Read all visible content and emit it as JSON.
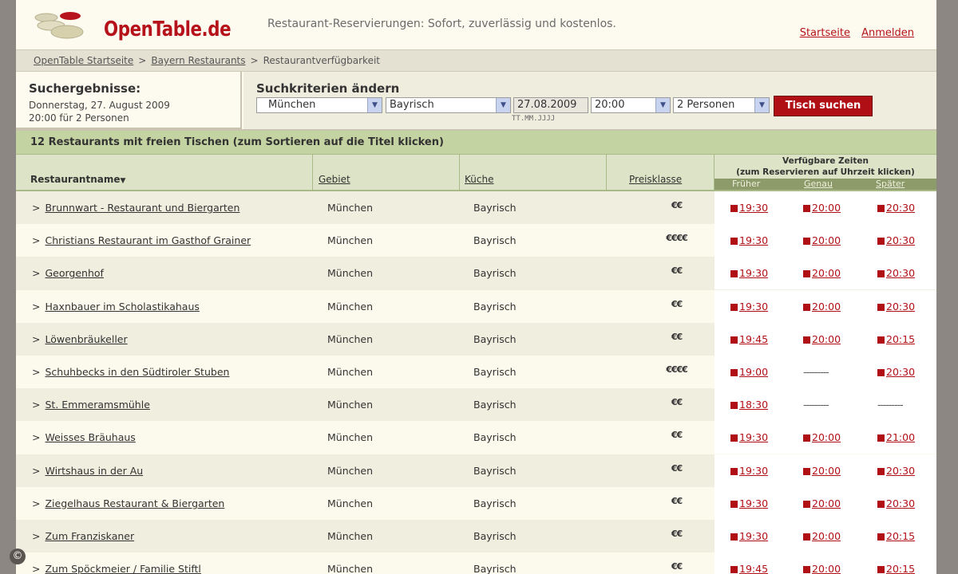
{
  "header": {
    "logo_text": "OpenTable.de",
    "tagline": "Restaurant-Reservierungen: Sofort, zuverlässig und kostenlos.",
    "links": [
      "Startseite",
      "Anmelden"
    ]
  },
  "breadcrumb": [
    "OpenTable Startseite",
    "Bayern Restaurants",
    "Restaurantverfügbarkeit"
  ],
  "results": {
    "title": "Suchergebnisse:",
    "date_line": "Donnerstag, 27. August 2009",
    "time_line": "20:00 für 2 Personen"
  },
  "criteria": {
    "title": "Suchkriterien ändern",
    "city": "München",
    "cuisine": "Bayrisch",
    "date": "27.08.2009",
    "date_hint": "TT.MM.JJJJ",
    "time": "20:00",
    "people": "2 Personen",
    "search_button": "Tisch suchen"
  },
  "count_text": "12 Restaurants mit freien Tischen (zum Sortieren auf die Titel klicken)",
  "table": {
    "headers": {
      "name": "Restaurantname",
      "area": "Gebiet",
      "kitchen": "Küche",
      "price": "Preisklasse",
      "avail_title": "Verfügbare Zeiten",
      "avail_sub": "(zum Reservieren auf Uhrzeit klicken)",
      "earlier": "Früher",
      "exact": "Genau",
      "later": "Später"
    },
    "rows": [
      {
        "name": "Brunnwart - Restaurant und Biergarten",
        "area": "München",
        "kitchen": "Bayrisch",
        "price": "€€",
        "early": "19:30",
        "exact": "20:00",
        "late": "20:30"
      },
      {
        "name": "Christians Restaurant im Gasthof Grainer",
        "area": "München",
        "kitchen": "Bayrisch",
        "price": "€€€€",
        "early": "19:30",
        "exact": "20:00",
        "late": "20:30"
      },
      {
        "name": "Georgenhof",
        "area": "München",
        "kitchen": "Bayrisch",
        "price": "€€",
        "early": "19:30",
        "exact": "20:00",
        "late": "20:30"
      },
      {
        "name": "Haxnbauer im Scholastikahaus",
        "area": "München",
        "kitchen": "Bayrisch",
        "price": "€€",
        "early": "19:30",
        "exact": "20:00",
        "late": "20:30"
      },
      {
        "name": "Löwenbräukeller",
        "area": "München",
        "kitchen": "Bayrisch",
        "price": "€€",
        "early": "19:45",
        "exact": "20:00",
        "late": "20:15"
      },
      {
        "name": "Schuhbecks in den Südtiroler Stuben",
        "area": "München",
        "kitchen": "Bayrisch",
        "price": "€€€€",
        "early": "19:00",
        "exact": "---------",
        "late": "20:30"
      },
      {
        "name": "St. Emmeramsmühle",
        "area": "München",
        "kitchen": "Bayrisch",
        "price": "€€",
        "early": "18:30",
        "exact": "---------",
        "late": "---------"
      },
      {
        "name": "Weisses Bräuhaus",
        "area": "München",
        "kitchen": "Bayrisch",
        "price": "€€",
        "early": "19:30",
        "exact": "20:00",
        "late": "21:00"
      },
      {
        "name": "Wirtshaus in der Au",
        "area": "München",
        "kitchen": "Bayrisch",
        "price": "€€",
        "early": "19:30",
        "exact": "20:00",
        "late": "20:30"
      },
      {
        "name": "Ziegelhaus Restaurant & Biergarten",
        "area": "München",
        "kitchen": "Bayrisch",
        "price": "€€",
        "early": "19:30",
        "exact": "20:00",
        "late": "20:30"
      },
      {
        "name": "Zum Franziskaner",
        "area": "München",
        "kitchen": "Bayrisch",
        "price": "€€",
        "early": "19:30",
        "exact": "20:00",
        "late": "20:15"
      },
      {
        "name": "Zum Spöckmeier / Familie Stiftl",
        "area": "München",
        "kitchen": "Bayrisch",
        "price": "€€",
        "early": "19:45",
        "exact": "20:00",
        "late": "20:15"
      }
    ]
  },
  "colors": {
    "brand_red": "#b10f16",
    "count_bar": "#c4d3a2",
    "header_bg": "#fdfbef"
  }
}
